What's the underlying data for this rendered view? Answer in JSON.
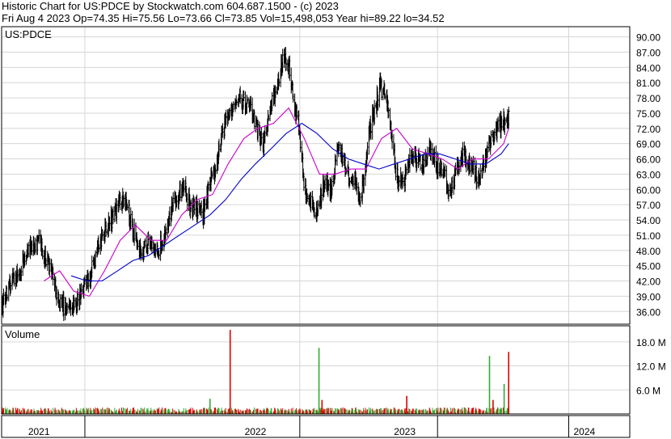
{
  "header": {
    "title_line": "Historic Chart for US:PDCE by Stockwatch.com 604.687.1500 - (c) 2023",
    "quote_line": "Fri Aug  4 2023   Op=74.35  Hi=75.56  Lo=73.66  Cl=73.85  Vol=15,498,053  Year hi=89.22  lo=34.52"
  },
  "chart_data": [
    {
      "type": "line",
      "panel": "price",
      "title": "US:PDCE",
      "ylim": [
        33.5,
        92
      ],
      "price_ticks": [
        "90.00",
        "87.00",
        "84.00",
        "81.00",
        "78.00",
        "75.00",
        "72.00",
        "69.00",
        "66.00",
        "63.00",
        "60.00",
        "57.00",
        "54.00",
        "51.00",
        "48.00",
        "45.00",
        "42.00",
        "39.00",
        "36.00"
      ],
      "x_labels": [
        "2021",
        "2022",
        "2023",
        "2024"
      ],
      "x_range": [
        "2020-11-02",
        "2024-03-31"
      ],
      "year_boundaries": [
        "2021-04-16",
        "2022-06-16",
        "2023-03-16",
        "2023-12-01"
      ],
      "series": [
        {
          "kind": "daily high-low bars",
          "color": "#000000",
          "points": [
            [
              "2020-11-02",
              37
            ],
            [
              "2020-11-20",
              41
            ],
            [
              "2020-12-05",
              43
            ],
            [
              "2020-12-18",
              47
            ],
            [
              "2021-01-05",
              49
            ],
            [
              "2021-01-15",
              50
            ],
            [
              "2021-01-30",
              46
            ],
            [
              "2021-02-10",
              43
            ],
            [
              "2021-02-25",
              38
            ],
            [
              "2021-03-12",
              36
            ],
            [
              "2021-03-28",
              37
            ],
            [
              "2021-04-12",
              41
            ],
            [
              "2021-04-26",
              43
            ],
            [
              "2021-05-10",
              48
            ],
            [
              "2021-05-24",
              52
            ],
            [
              "2021-06-08",
              54
            ],
            [
              "2021-06-22",
              57
            ],
            [
              "2021-07-06",
              58
            ],
            [
              "2021-07-20",
              52
            ],
            [
              "2021-08-06",
              48
            ],
            [
              "2021-08-20",
              49
            ],
            [
              "2021-09-03",
              47
            ],
            [
              "2021-09-16",
              50
            ],
            [
              "2021-09-30",
              55
            ],
            [
              "2021-10-14",
              58
            ],
            [
              "2021-10-28",
              61
            ],
            [
              "2021-11-10",
              57
            ],
            [
              "2021-11-24",
              56
            ],
            [
              "2021-12-06",
              55
            ],
            [
              "2021-12-18",
              60
            ],
            [
              "2022-01-02",
              65
            ],
            [
              "2022-01-16",
              72
            ],
            [
              "2022-01-30",
              76
            ],
            [
              "2022-02-14",
              78
            ],
            [
              "2022-02-28",
              77
            ],
            [
              "2022-03-12",
              76
            ],
            [
              "2022-03-26",
              71
            ],
            [
              "2022-04-06",
              69
            ],
            [
              "2022-04-18",
              76
            ],
            [
              "2022-05-02",
              80
            ],
            [
              "2022-05-14",
              86
            ],
            [
              "2022-05-26",
              84
            ],
            [
              "2022-06-04",
              77
            ],
            [
              "2022-06-14",
              73
            ],
            [
              "2022-06-24",
              61
            ],
            [
              "2022-07-06",
              58
            ],
            [
              "2022-07-16",
              55
            ],
            [
              "2022-07-26",
              58
            ],
            [
              "2022-08-06",
              62
            ],
            [
              "2022-08-18",
              60
            ],
            [
              "2022-08-30",
              68
            ],
            [
              "2022-09-10",
              66
            ],
            [
              "2022-09-22",
              62
            ],
            [
              "2022-10-04",
              61
            ],
            [
              "2022-10-14",
              57
            ],
            [
              "2022-10-22",
              63
            ],
            [
              "2022-11-02",
              72
            ],
            [
              "2022-11-12",
              76
            ],
            [
              "2022-11-22",
              80
            ],
            [
              "2022-12-02",
              79
            ],
            [
              "2022-12-12",
              73
            ],
            [
              "2022-12-24",
              63
            ],
            [
              "2023-01-06",
              61
            ],
            [
              "2023-01-20",
              66
            ],
            [
              "2023-02-04",
              66
            ],
            [
              "2023-02-16",
              64
            ],
            [
              "2023-03-01",
              68
            ],
            [
              "2023-03-14",
              65
            ],
            [
              "2023-03-28",
              64
            ],
            [
              "2023-04-08",
              58
            ],
            [
              "2023-04-20",
              63
            ],
            [
              "2023-05-02",
              67
            ],
            [
              "2023-05-14",
              66
            ],
            [
              "2023-05-26",
              64
            ],
            [
              "2023-06-06",
              62
            ],
            [
              "2023-06-18",
              66
            ],
            [
              "2023-06-30",
              70
            ],
            [
              "2023-07-12",
              72
            ],
            [
              "2023-07-24",
              73
            ],
            [
              "2023-08-04",
              74
            ]
          ]
        },
        {
          "kind": "moving average (short)",
          "color": "#cc00cc",
          "points": [
            [
              "2021-01-25",
              42
            ],
            [
              "2021-02-25",
              44
            ],
            [
              "2021-03-25",
              40
            ],
            [
              "2021-04-25",
              39
            ],
            [
              "2021-05-25",
              44
            ],
            [
              "2021-06-25",
              50
            ],
            [
              "2021-07-25",
              53
            ],
            [
              "2021-08-25",
              50
            ],
            [
              "2021-09-25",
              50
            ],
            [
              "2021-10-25",
              55
            ],
            [
              "2021-11-25",
              58
            ],
            [
              "2021-12-25",
              59
            ],
            [
              "2022-01-25",
              65
            ],
            [
              "2022-02-25",
              70
            ],
            [
              "2022-03-25",
              72
            ],
            [
              "2022-04-25",
              73
            ],
            [
              "2022-05-25",
              76
            ],
            [
              "2022-06-25",
              70
            ],
            [
              "2022-07-25",
              63
            ],
            [
              "2022-08-25",
              63
            ],
            [
              "2022-09-25",
              64
            ],
            [
              "2022-10-25",
              64
            ],
            [
              "2022-11-25",
              70
            ],
            [
              "2022-12-25",
              72
            ],
            [
              "2023-01-25",
              68
            ],
            [
              "2023-02-25",
              67
            ],
            [
              "2023-03-25",
              66
            ],
            [
              "2023-04-25",
              64
            ],
            [
              "2023-05-25",
              66
            ],
            [
              "2023-06-25",
              66
            ],
            [
              "2023-07-25",
              69
            ],
            [
              "2023-08-04",
              72
            ]
          ]
        },
        {
          "kind": "moving average (long)",
          "color": "#0000cc",
          "points": [
            [
              "2021-03-20",
              43
            ],
            [
              "2021-04-20",
              42
            ],
            [
              "2021-05-20",
              42
            ],
            [
              "2021-06-20",
              44
            ],
            [
              "2021-07-20",
              46
            ],
            [
              "2021-08-20",
              47
            ],
            [
              "2021-09-20",
              49
            ],
            [
              "2021-10-20",
              51
            ],
            [
              "2021-11-20",
              53
            ],
            [
              "2021-12-20",
              55
            ],
            [
              "2022-01-20",
              58
            ],
            [
              "2022-02-20",
              62
            ],
            [
              "2022-03-20",
              65
            ],
            [
              "2022-04-20",
              68
            ],
            [
              "2022-05-20",
              71
            ],
            [
              "2022-06-20",
              73
            ],
            [
              "2022-07-20",
              71
            ],
            [
              "2022-08-20",
              68
            ],
            [
              "2022-09-20",
              66
            ],
            [
              "2022-10-20",
              65
            ],
            [
              "2022-11-20",
              64
            ],
            [
              "2022-12-20",
              65
            ],
            [
              "2023-01-20",
              66
            ],
            [
              "2023-02-20",
              67
            ],
            [
              "2023-03-20",
              67
            ],
            [
              "2023-04-20",
              66
            ],
            [
              "2023-05-20",
              65
            ],
            [
              "2023-06-20",
              65
            ],
            [
              "2023-07-20",
              67
            ],
            [
              "2023-08-04",
              69
            ]
          ]
        }
      ]
    },
    {
      "type": "bar",
      "panel": "volume",
      "title": "Volume",
      "ylim": [
        0,
        22
      ],
      "unit": "M",
      "volume_ticks": [
        "18.0 M",
        "12.0 M",
        "6.0 M"
      ],
      "tick_values": [
        18,
        12,
        6
      ],
      "typical_volume": 1.2,
      "spikes": [
        {
          "date": "2021-12-20",
          "value": 3.8,
          "color": "#33aa33"
        },
        {
          "date": "2022-01-29",
          "value": 21.0,
          "color": "#dd0000"
        },
        {
          "date": "2022-07-24",
          "value": 16.5,
          "color": "#33aa33"
        },
        {
          "date": "2022-07-30",
          "value": 3.5,
          "color": "#dd0000"
        },
        {
          "date": "2023-01-14",
          "value": 4.5,
          "color": "#dd0000"
        },
        {
          "date": "2023-06-27",
          "value": 14.5,
          "color": "#33aa33"
        },
        {
          "date": "2023-07-04",
          "value": 3.5,
          "color": "#dd0000"
        },
        {
          "date": "2023-07-26",
          "value": 7.5,
          "color": "#33aa33"
        },
        {
          "date": "2023-08-04",
          "value": 15.5,
          "color": "#dd0000"
        }
      ],
      "colors": {
        "up": "#33aa33",
        "down": "#dd0000"
      }
    }
  ],
  "styles": {
    "grid_color": "#d6d6d6",
    "frame_color": "#000000"
  }
}
